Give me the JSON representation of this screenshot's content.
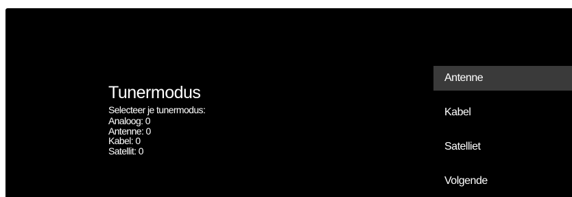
{
  "setup": {
    "title": "Tunermodus",
    "prompt": "Selecteer je tunermodus:",
    "counts": [
      "Analoog: 0",
      "Antenne: 0",
      "Kabel: 0",
      "Satellit: 0"
    ]
  },
  "menu": {
    "selected_index": 0,
    "items": [
      {
        "label": "Antenne"
      },
      {
        "label": "Kabel"
      },
      {
        "label": "Satelliet"
      },
      {
        "label": "Volgende"
      }
    ]
  },
  "colors": {
    "background": "#000000",
    "selection": "#3a3a3a",
    "text": "#ffffff"
  }
}
